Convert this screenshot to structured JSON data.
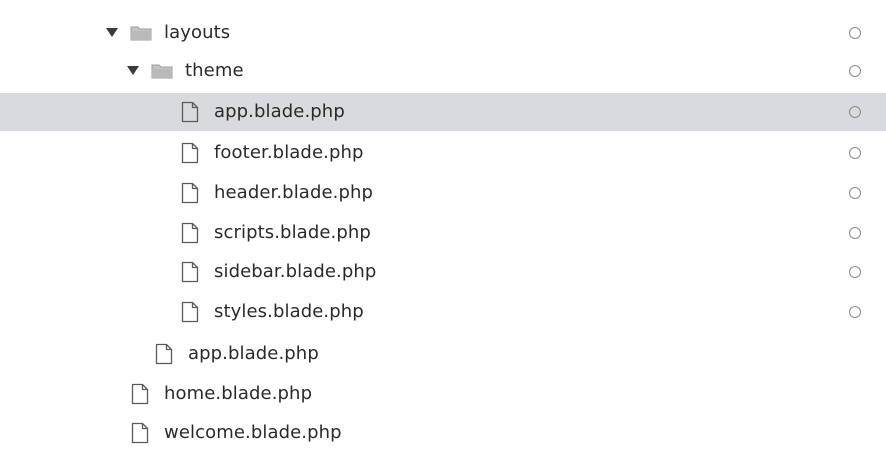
{
  "tree": {
    "folders": [
      {
        "label": "layouts",
        "expanded": true,
        "icon": "folder-icon",
        "arrow_icon": "triangle-down-icon"
      },
      {
        "label": "theme",
        "expanded": true,
        "icon": "folder-icon",
        "arrow_icon": "triangle-down-icon"
      }
    ],
    "theme_files": [
      {
        "label": "app.blade.php",
        "selected": true,
        "status_icon": "circle-outline-icon"
      },
      {
        "label": "footer.blade.php",
        "selected": false,
        "status_icon": "circle-outline-icon"
      },
      {
        "label": "header.blade.php",
        "selected": false,
        "status_icon": "circle-outline-icon"
      },
      {
        "label": "scripts.blade.php",
        "selected": false,
        "status_icon": "circle-outline-icon"
      },
      {
        "label": "sidebar.blade.php",
        "selected": false,
        "status_icon": "circle-outline-icon"
      },
      {
        "label": "styles.blade.php",
        "selected": false,
        "status_icon": "circle-outline-icon"
      }
    ],
    "layouts_files": [
      {
        "label": "app.blade.php"
      }
    ],
    "root_files": [
      {
        "label": "home.blade.php"
      },
      {
        "label": "welcome.blade.php"
      }
    ]
  },
  "colors": {
    "selected_row": "#d9dadd",
    "folder_fill": "#bdbdbd",
    "text": "#2a2a2a",
    "status_circle": "#8a8a8a"
  }
}
